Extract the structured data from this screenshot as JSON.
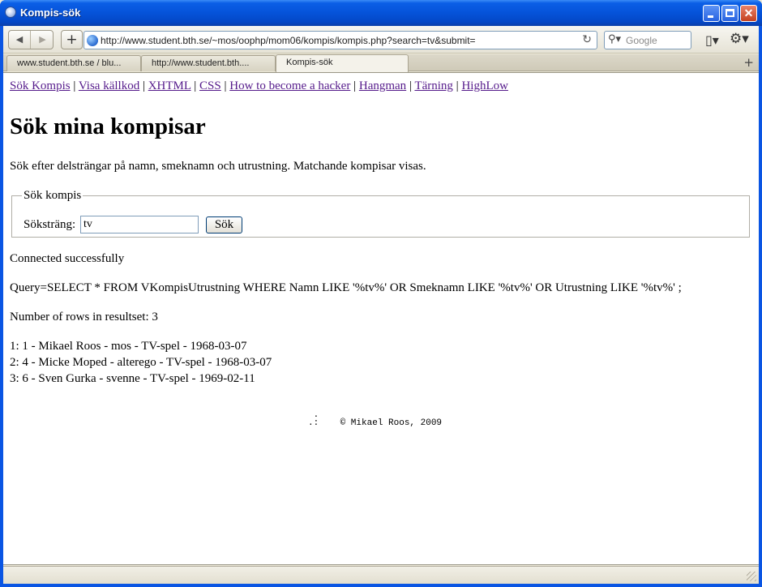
{
  "window": {
    "title": "Kompis-sök",
    "controls": {
      "minimize": "",
      "maximize": "",
      "close": "✕"
    }
  },
  "toolbar": {
    "back": "◀",
    "forward": "▶",
    "new_tab": "+",
    "url": "http://www.student.bth.se/~mos/oophp/mom06/kompis/kompis.php?search=tv&submit=",
    "reload": "↻",
    "search_placeholder": "Google",
    "search_icon": "magnifier-icon",
    "page_icon": "page-icon",
    "gear_icon": "gear-icon"
  },
  "tabs": [
    {
      "label": "www.student.bth.se / blu..."
    },
    {
      "label": "http://www.student.bth...."
    },
    {
      "label": "Kompis-sök",
      "active": true
    }
  ],
  "tab_add": "+",
  "page": {
    "nav": [
      {
        "label": "Sök Kompis"
      },
      {
        "label": "Visa källkod"
      },
      {
        "label": "XHTML"
      },
      {
        "label": "CSS"
      },
      {
        "label": "How to become a hacker"
      },
      {
        "label": "Hangman"
      },
      {
        "label": "Tärning"
      },
      {
        "label": "HighLow"
      }
    ],
    "nav_separator": "|",
    "heading": "Sök mina kompisar",
    "intro": "Sök efter delsträngar på namn, smeknamn och utrustning. Matchande kompisar visas.",
    "form": {
      "legend": "Sök kompis",
      "label": "Söksträng:",
      "value": "tv",
      "button": "Sök"
    },
    "status": "Connected successfully",
    "query": "Query=SELECT * FROM VKompisUtrustning WHERE Namn LIKE '%tv%' OR Smeknamn LIKE '%tv%' OR Utrustning LIKE '%tv%' ;",
    "rowcount": "Number of rows in resultset: 3",
    "results": [
      "1: 1 - Mikael Roos - mos - TV-spel - 1968-03-07",
      "2: 4 - Micke Moped - alterego - TV-spel - 1968-03-07",
      "3: 6 - Sven Gurka - svenne - TV-spel - 1969-02-11"
    ],
    "footer": {
      "logo_top": " .",
      "logo_bottom": ".:",
      "copyright": "© Mikael Roos, 2009"
    }
  }
}
